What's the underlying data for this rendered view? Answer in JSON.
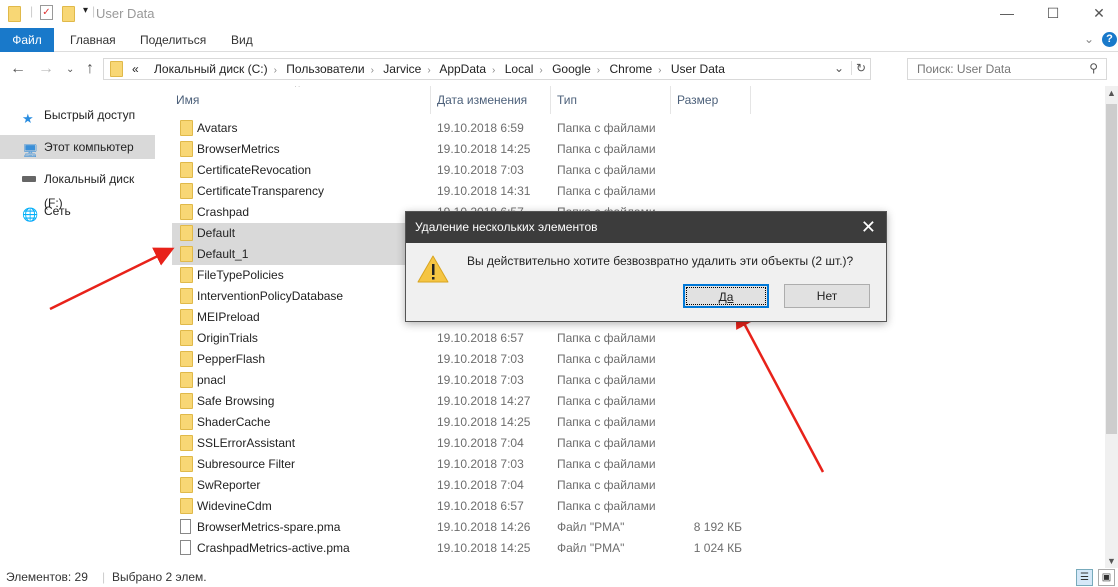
{
  "window": {
    "title": "User Data",
    "minimize_icon": "minimize-icon",
    "maximize_icon": "maximize-icon",
    "close_icon": "close-icon"
  },
  "ribbon": {
    "tabs": [
      "Файл",
      "Главная",
      "Поделиться",
      "Вид"
    ]
  },
  "address": {
    "crumbs_prefix": "«",
    "crumbs": [
      "Локальный диск (C:)",
      "Пользователи",
      "Jarvice",
      "AppData",
      "Local",
      "Google",
      "Chrome",
      "User Data"
    ]
  },
  "search": {
    "placeholder": "Поиск: User Data"
  },
  "sidebar": {
    "items": [
      {
        "label": "Быстрый доступ",
        "icon": "star-icon"
      },
      {
        "label": "Этот компьютер",
        "icon": "computer-icon",
        "selected": true
      },
      {
        "label": "Локальный диск (F:)",
        "icon": "drive-icon"
      },
      {
        "label": "Сеть",
        "icon": "network-icon"
      }
    ]
  },
  "columns": [
    "Имя",
    "Дата изменения",
    "Тип",
    "Размер"
  ],
  "rows": [
    {
      "name": "Avatars",
      "date": "19.10.2018 6:59",
      "type": "Папка с файлами",
      "size": "",
      "kind": "folder"
    },
    {
      "name": "BrowserMetrics",
      "date": "19.10.2018 14:25",
      "type": "Папка с файлами",
      "size": "",
      "kind": "folder"
    },
    {
      "name": "CertificateRevocation",
      "date": "19.10.2018 7:03",
      "type": "Папка с файлами",
      "size": "",
      "kind": "folder"
    },
    {
      "name": "CertificateTransparency",
      "date": "19.10.2018 14:31",
      "type": "Папка с файлами",
      "size": "",
      "kind": "folder"
    },
    {
      "name": "Crashpad",
      "date": "19.10.2018 6:57",
      "type": "Папка с файлами",
      "size": "",
      "kind": "folder"
    },
    {
      "name": "Default",
      "date": "",
      "type": "",
      "size": "",
      "kind": "folder",
      "selected": true
    },
    {
      "name": "Default_1",
      "date": "",
      "type": "",
      "size": "",
      "kind": "folder",
      "selected": true
    },
    {
      "name": "FileTypePolicies",
      "date": "",
      "type": "",
      "size": "",
      "kind": "folder"
    },
    {
      "name": "InterventionPolicyDatabase",
      "date": "",
      "type": "",
      "size": "",
      "kind": "folder"
    },
    {
      "name": "MEIPreload",
      "date": "",
      "type": "",
      "size": "",
      "kind": "folder"
    },
    {
      "name": "OriginTrials",
      "date": "19.10.2018 6:57",
      "type": "Папка с файлами",
      "size": "",
      "kind": "folder"
    },
    {
      "name": "PepperFlash",
      "date": "19.10.2018 7:03",
      "type": "Папка с файлами",
      "size": "",
      "kind": "folder"
    },
    {
      "name": "pnacl",
      "date": "19.10.2018 7:03",
      "type": "Папка с файлами",
      "size": "",
      "kind": "folder"
    },
    {
      "name": "Safe Browsing",
      "date": "19.10.2018 14:27",
      "type": "Папка с файлами",
      "size": "",
      "kind": "folder"
    },
    {
      "name": "ShaderCache",
      "date": "19.10.2018 14:25",
      "type": "Папка с файлами",
      "size": "",
      "kind": "folder"
    },
    {
      "name": "SSLErrorAssistant",
      "date": "19.10.2018 7:04",
      "type": "Папка с файлами",
      "size": "",
      "kind": "folder"
    },
    {
      "name": "Subresource Filter",
      "date": "19.10.2018 7:03",
      "type": "Папка с файлами",
      "size": "",
      "kind": "folder"
    },
    {
      "name": "SwReporter",
      "date": "19.10.2018 7:04",
      "type": "Папка с файлами",
      "size": "",
      "kind": "folder"
    },
    {
      "name": "WidevineCdm",
      "date": "19.10.2018 6:57",
      "type": "Папка с файлами",
      "size": "",
      "kind": "folder"
    },
    {
      "name": "BrowserMetrics-spare.pma",
      "date": "19.10.2018 14:26",
      "type": "Файл \"PMA\"",
      "size": "8 192 КБ",
      "kind": "file"
    },
    {
      "name": "CrashpadMetrics-active.pma",
      "date": "19.10.2018 14:25",
      "type": "Файл \"PMA\"",
      "size": "1 024 КБ",
      "kind": "file"
    }
  ],
  "status": {
    "count": "Элементов: 29",
    "selected": "Выбрано 2 элем."
  },
  "dialog": {
    "title": "Удаление нескольких элементов",
    "message": "Вы действительно хотите безвозвратно удалить эти объекты (2 шт.)?",
    "yes": "Да",
    "no": "Нет",
    "icon": "warning-icon"
  },
  "colors": {
    "accent": "#1979ca",
    "dialog_title": "#3c3c3c",
    "selection": "#d9d9d9",
    "annotation_arrow": "#e8221a"
  }
}
